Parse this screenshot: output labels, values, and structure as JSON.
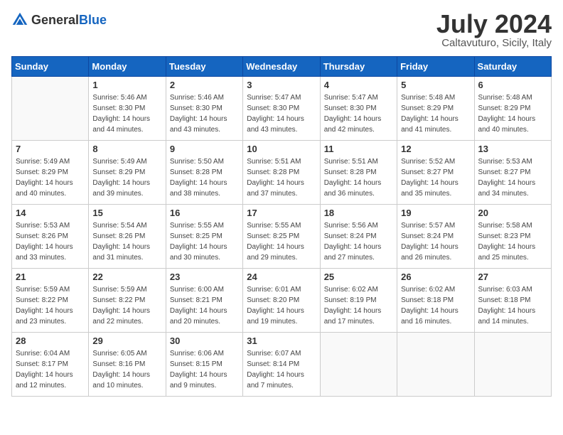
{
  "header": {
    "logo_general": "General",
    "logo_blue": "Blue",
    "month_title": "July 2024",
    "subtitle": "Caltavuturo, Sicily, Italy"
  },
  "weekdays": [
    "Sunday",
    "Monday",
    "Tuesday",
    "Wednesday",
    "Thursday",
    "Friday",
    "Saturday"
  ],
  "weeks": [
    [
      {
        "day": "",
        "sunrise": "",
        "sunset": "",
        "daylight": ""
      },
      {
        "day": "1",
        "sunrise": "Sunrise: 5:46 AM",
        "sunset": "Sunset: 8:30 PM",
        "daylight": "Daylight: 14 hours and 44 minutes."
      },
      {
        "day": "2",
        "sunrise": "Sunrise: 5:46 AM",
        "sunset": "Sunset: 8:30 PM",
        "daylight": "Daylight: 14 hours and 43 minutes."
      },
      {
        "day": "3",
        "sunrise": "Sunrise: 5:47 AM",
        "sunset": "Sunset: 8:30 PM",
        "daylight": "Daylight: 14 hours and 43 minutes."
      },
      {
        "day": "4",
        "sunrise": "Sunrise: 5:47 AM",
        "sunset": "Sunset: 8:30 PM",
        "daylight": "Daylight: 14 hours and 42 minutes."
      },
      {
        "day": "5",
        "sunrise": "Sunrise: 5:48 AM",
        "sunset": "Sunset: 8:29 PM",
        "daylight": "Daylight: 14 hours and 41 minutes."
      },
      {
        "day": "6",
        "sunrise": "Sunrise: 5:48 AM",
        "sunset": "Sunset: 8:29 PM",
        "daylight": "Daylight: 14 hours and 40 minutes."
      }
    ],
    [
      {
        "day": "7",
        "sunrise": "Sunrise: 5:49 AM",
        "sunset": "Sunset: 8:29 PM",
        "daylight": "Daylight: 14 hours and 40 minutes."
      },
      {
        "day": "8",
        "sunrise": "Sunrise: 5:49 AM",
        "sunset": "Sunset: 8:29 PM",
        "daylight": "Daylight: 14 hours and 39 minutes."
      },
      {
        "day": "9",
        "sunrise": "Sunrise: 5:50 AM",
        "sunset": "Sunset: 8:28 PM",
        "daylight": "Daylight: 14 hours and 38 minutes."
      },
      {
        "day": "10",
        "sunrise": "Sunrise: 5:51 AM",
        "sunset": "Sunset: 8:28 PM",
        "daylight": "Daylight: 14 hours and 37 minutes."
      },
      {
        "day": "11",
        "sunrise": "Sunrise: 5:51 AM",
        "sunset": "Sunset: 8:28 PM",
        "daylight": "Daylight: 14 hours and 36 minutes."
      },
      {
        "day": "12",
        "sunrise": "Sunrise: 5:52 AM",
        "sunset": "Sunset: 8:27 PM",
        "daylight": "Daylight: 14 hours and 35 minutes."
      },
      {
        "day": "13",
        "sunrise": "Sunrise: 5:53 AM",
        "sunset": "Sunset: 8:27 PM",
        "daylight": "Daylight: 14 hours and 34 minutes."
      }
    ],
    [
      {
        "day": "14",
        "sunrise": "Sunrise: 5:53 AM",
        "sunset": "Sunset: 8:26 PM",
        "daylight": "Daylight: 14 hours and 33 minutes."
      },
      {
        "day": "15",
        "sunrise": "Sunrise: 5:54 AM",
        "sunset": "Sunset: 8:26 PM",
        "daylight": "Daylight: 14 hours and 31 minutes."
      },
      {
        "day": "16",
        "sunrise": "Sunrise: 5:55 AM",
        "sunset": "Sunset: 8:25 PM",
        "daylight": "Daylight: 14 hours and 30 minutes."
      },
      {
        "day": "17",
        "sunrise": "Sunrise: 5:55 AM",
        "sunset": "Sunset: 8:25 PM",
        "daylight": "Daylight: 14 hours and 29 minutes."
      },
      {
        "day": "18",
        "sunrise": "Sunrise: 5:56 AM",
        "sunset": "Sunset: 8:24 PM",
        "daylight": "Daylight: 14 hours and 27 minutes."
      },
      {
        "day": "19",
        "sunrise": "Sunrise: 5:57 AM",
        "sunset": "Sunset: 8:24 PM",
        "daylight": "Daylight: 14 hours and 26 minutes."
      },
      {
        "day": "20",
        "sunrise": "Sunrise: 5:58 AM",
        "sunset": "Sunset: 8:23 PM",
        "daylight": "Daylight: 14 hours and 25 minutes."
      }
    ],
    [
      {
        "day": "21",
        "sunrise": "Sunrise: 5:59 AM",
        "sunset": "Sunset: 8:22 PM",
        "daylight": "Daylight: 14 hours and 23 minutes."
      },
      {
        "day": "22",
        "sunrise": "Sunrise: 5:59 AM",
        "sunset": "Sunset: 8:22 PM",
        "daylight": "Daylight: 14 hours and 22 minutes."
      },
      {
        "day": "23",
        "sunrise": "Sunrise: 6:00 AM",
        "sunset": "Sunset: 8:21 PM",
        "daylight": "Daylight: 14 hours and 20 minutes."
      },
      {
        "day": "24",
        "sunrise": "Sunrise: 6:01 AM",
        "sunset": "Sunset: 8:20 PM",
        "daylight": "Daylight: 14 hours and 19 minutes."
      },
      {
        "day": "25",
        "sunrise": "Sunrise: 6:02 AM",
        "sunset": "Sunset: 8:19 PM",
        "daylight": "Daylight: 14 hours and 17 minutes."
      },
      {
        "day": "26",
        "sunrise": "Sunrise: 6:02 AM",
        "sunset": "Sunset: 8:18 PM",
        "daylight": "Daylight: 14 hours and 16 minutes."
      },
      {
        "day": "27",
        "sunrise": "Sunrise: 6:03 AM",
        "sunset": "Sunset: 8:18 PM",
        "daylight": "Daylight: 14 hours and 14 minutes."
      }
    ],
    [
      {
        "day": "28",
        "sunrise": "Sunrise: 6:04 AM",
        "sunset": "Sunset: 8:17 PM",
        "daylight": "Daylight: 14 hours and 12 minutes."
      },
      {
        "day": "29",
        "sunrise": "Sunrise: 6:05 AM",
        "sunset": "Sunset: 8:16 PM",
        "daylight": "Daylight: 14 hours and 10 minutes."
      },
      {
        "day": "30",
        "sunrise": "Sunrise: 6:06 AM",
        "sunset": "Sunset: 8:15 PM",
        "daylight": "Daylight: 14 hours and 9 minutes."
      },
      {
        "day": "31",
        "sunrise": "Sunrise: 6:07 AM",
        "sunset": "Sunset: 8:14 PM",
        "daylight": "Daylight: 14 hours and 7 minutes."
      },
      {
        "day": "",
        "sunrise": "",
        "sunset": "",
        "daylight": ""
      },
      {
        "day": "",
        "sunrise": "",
        "sunset": "",
        "daylight": ""
      },
      {
        "day": "",
        "sunrise": "",
        "sunset": "",
        "daylight": ""
      }
    ]
  ]
}
